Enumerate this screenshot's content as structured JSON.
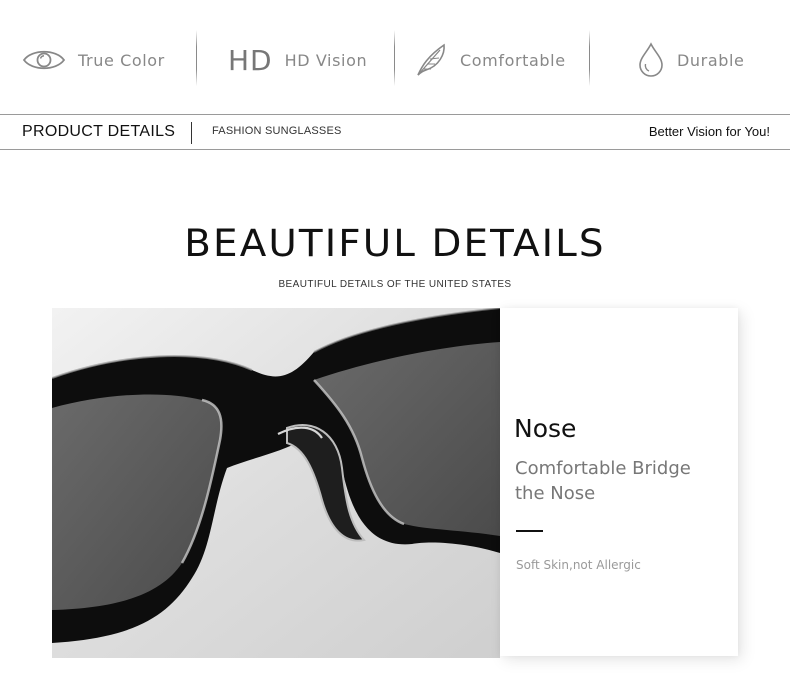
{
  "features": [
    {
      "icon": "eye-icon",
      "label": "True Color"
    },
    {
      "icon": "hd-icon",
      "mark": "HD",
      "label": "HD Vision"
    },
    {
      "icon": "feather-icon",
      "label": "Comfortable"
    },
    {
      "icon": "water-drop-icon",
      "label": "Durable"
    }
  ],
  "product_bar": {
    "title": "PRODUCT DETAILS",
    "subtitle": "FASHION SUNGLASSES",
    "tagline": "Better Vision for You!"
  },
  "section": {
    "heading": "BEAUTIFUL DETAILS",
    "subheading": "BEAUTIFUL DETAILS OF THE UNITED STATES"
  },
  "detail_card": {
    "title": "Nose",
    "description": "Comfortable Bridge the Nose",
    "note": "Soft Skin,not Allergic"
  },
  "colors": {
    "feature_text": "#888888",
    "frame": "#0d0d0d",
    "lens": "#5a5a5a",
    "photo_bg": "#e2e2e2"
  }
}
